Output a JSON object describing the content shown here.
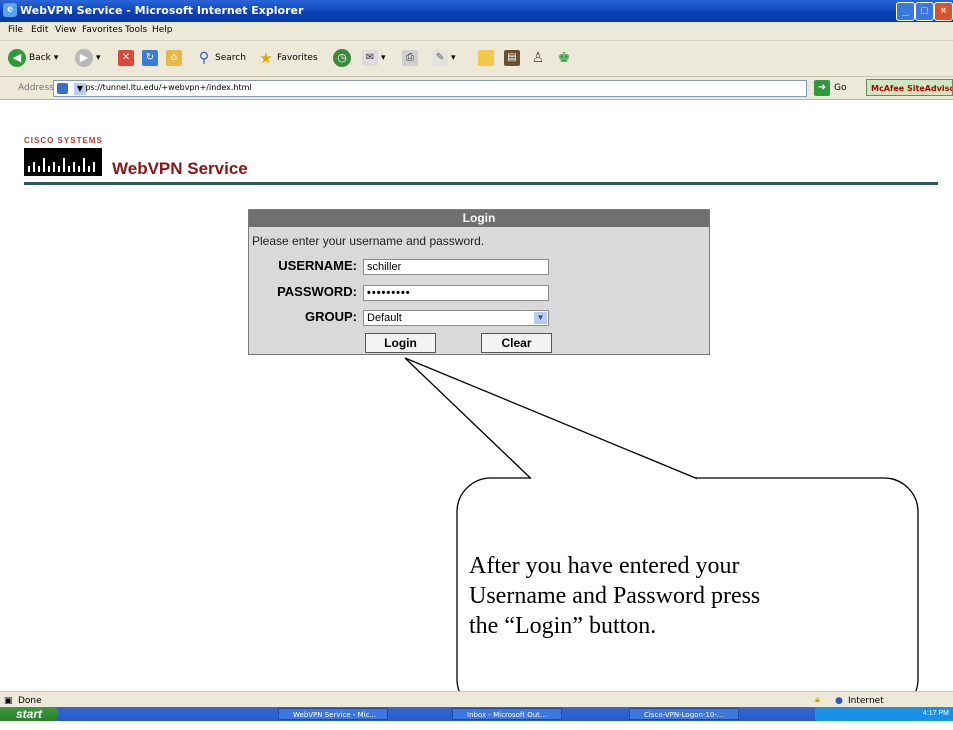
{
  "window": {
    "title": "WebVPN Service - Microsoft Internet Explorer"
  },
  "menu": [
    "File",
    "Edit",
    "View",
    "Favorites",
    "Tools",
    "Help"
  ],
  "toolbar": {
    "back_label": "Back",
    "search_label": "Search",
    "favorites_label": "Favorites"
  },
  "address": {
    "label": "Address",
    "url": "https://tunnel.ltu.edu/+webvpn+/index.html",
    "go_label": "Go",
    "mcafee_label": "McAfee SiteAdvisor"
  },
  "brand": {
    "cisco_text": "CISCO SYSTEMS",
    "service_title": "WebVPN Service"
  },
  "login": {
    "header": "Login",
    "instruction": "Please enter your username and password.",
    "username_label": "USERNAME:",
    "username_value": "schiller",
    "password_label": "PASSWORD:",
    "password_value": "•••••••••",
    "group_label": "GROUP:",
    "group_value": "Default",
    "login_button": "Login",
    "clear_button": "Clear"
  },
  "callout": {
    "text": "After you have entered your Username and Password press the “Login” button."
  },
  "status": {
    "left": "Done",
    "zone": "Internet"
  },
  "taskbar": {
    "start": "start",
    "tasks": [
      "WebVPN Service - Mic...",
      "Inbox - Microsoft Out...",
      "Cisco-VPN-Logon-10-..."
    ],
    "clock": "4:17 PM"
  }
}
